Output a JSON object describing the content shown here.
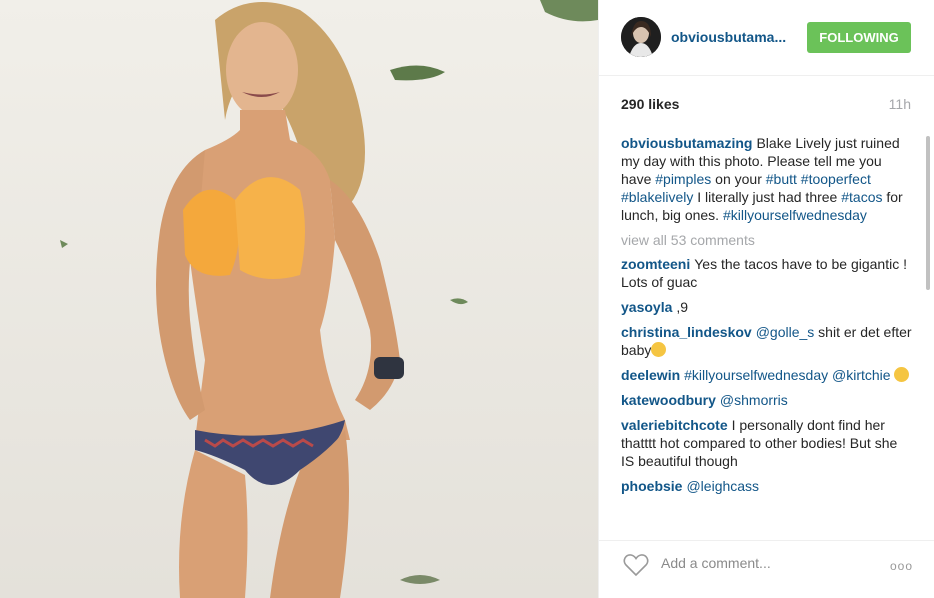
{
  "post": {
    "username": "obviousbutama...",
    "follow_label": "FOLLOWING",
    "likes": "290 likes",
    "time": "11h",
    "caption": {
      "user": "obviousbutamazing",
      "parts": [
        {
          "t": "Blake Lively just ruined my day with this photo. Please tell me you have "
        },
        {
          "tag": "#pimples"
        },
        {
          "t": " on your "
        },
        {
          "tag": "#butt"
        },
        {
          "t": " "
        },
        {
          "tag": "#tooperfect"
        },
        {
          "t": " "
        },
        {
          "tag": "#blakelively"
        },
        {
          "t": " I literally just had three "
        },
        {
          "tag": "#tacos"
        },
        {
          "t": " for lunch, big ones. "
        },
        {
          "tag": "#killyourselfwednesday"
        }
      ]
    },
    "view_all": "view all 53 comments",
    "comments": [
      {
        "user": "zoomteeni",
        "parts": [
          {
            "t": "Yes the tacos have to be gigantic ! Lots of guac"
          }
        ]
      },
      {
        "user": "yasoyla",
        "parts": [
          {
            "t": ",9"
          }
        ]
      },
      {
        "user": "christina_lindeskov",
        "parts": [
          {
            "tag": "@golle_s"
          },
          {
            "t": " shit er det efter baby"
          },
          {
            "emoji": "flushed-emoji"
          }
        ]
      },
      {
        "user": "deelewin",
        "parts": [
          {
            "tag": "#killyourselfwednesday"
          },
          {
            "t": " "
          },
          {
            "tag": "@kirtchie"
          },
          {
            "t": " "
          },
          {
            "emoji": "laughing-emoji"
          }
        ]
      },
      {
        "user": "katewoodbury",
        "parts": [
          {
            "tag": "@shmorris"
          }
        ]
      },
      {
        "user": "valeriebitchcote",
        "parts": [
          {
            "t": "I personally dont find her thatttt hot compared to other bodies! But she IS beautiful though"
          }
        ]
      },
      {
        "user": "phoebsie",
        "parts": [
          {
            "tag": "@leighcass"
          }
        ]
      }
    ],
    "add_comment_placeholder": "Add a comment...",
    "more_label": "ooo"
  },
  "colors": {
    "link": "#125688",
    "follow": "#6bc259",
    "muted": "#a5a7aa"
  },
  "icons": {
    "like": "heart-icon",
    "more": "more-options-icon"
  }
}
